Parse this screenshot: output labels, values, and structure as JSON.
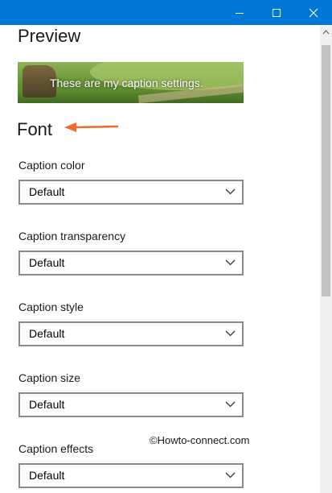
{
  "window": {
    "controls": {
      "minimize": "minimize-icon",
      "maximize": "maximize-icon",
      "close": "close-icon"
    },
    "accent_color": "#0078d7"
  },
  "preview": {
    "heading": "Preview",
    "caption_text": "These are my caption settings."
  },
  "font": {
    "heading": "Font",
    "annotation": "orange-arrow-icon",
    "arrow_color": "#f26a2e"
  },
  "fields": [
    {
      "label": "Caption color",
      "value": "Default"
    },
    {
      "label": "Caption transparency",
      "value": "Default"
    },
    {
      "label": "Caption style",
      "value": "Default"
    },
    {
      "label": "Caption size",
      "value": "Default"
    },
    {
      "label": "Caption effects",
      "value": "Default"
    }
  ],
  "watermark": "©Howto-connect.com"
}
